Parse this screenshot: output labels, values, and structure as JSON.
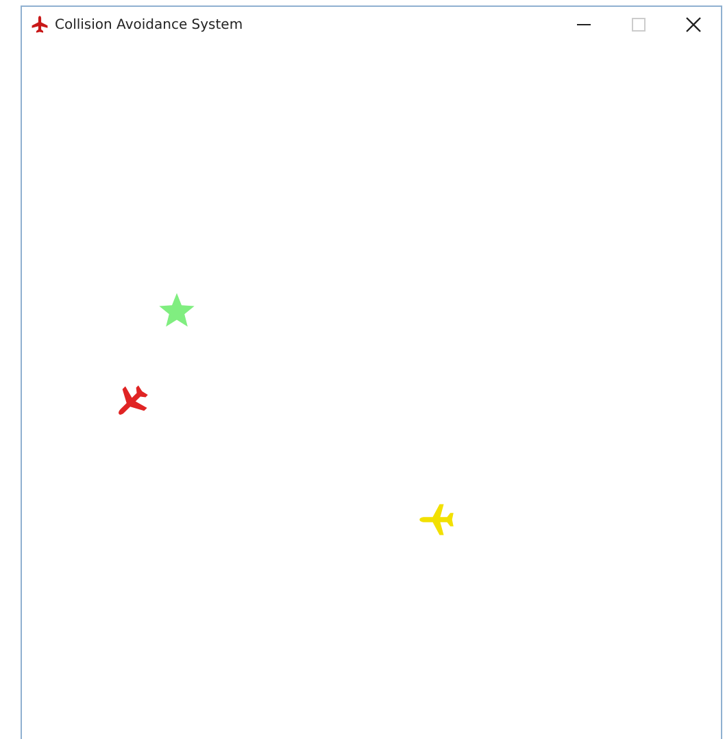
{
  "window": {
    "title": "Collision Avoidance System"
  },
  "canvas": {
    "objects": [
      {
        "kind": "star",
        "color": "#80ee80"
      },
      {
        "kind": "plane",
        "color": "#e02424"
      },
      {
        "kind": "plane",
        "color": "#f2e000"
      }
    ]
  }
}
